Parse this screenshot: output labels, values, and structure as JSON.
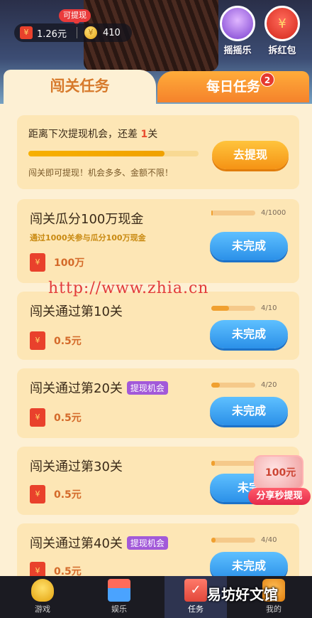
{
  "header": {
    "withdraw_tip": "可提现",
    "cash": "1.26元",
    "coins": "410",
    "shake_label": "摇摇乐",
    "red_packet_label": "拆红包"
  },
  "tabs": {
    "levels": "闯关任务",
    "daily": "每日任务",
    "daily_badge": "2"
  },
  "withdraw_card": {
    "title_prefix": "距离下次提现机会，还差 ",
    "remaining": "1",
    "title_suffix": "关",
    "progress": 0.8,
    "desc": "闯关即可提现！机会多多、金额不限！",
    "button": "去提现"
  },
  "tasks": [
    {
      "title": "闯关瓜分100万现金",
      "subtitle": "通过1000关参与瓜分100万现金",
      "reward": "100万",
      "progress_text": "4/1000",
      "progress": 0.004,
      "button": "未完成"
    },
    {
      "title": "闯关通过第10关",
      "reward": "0.5元",
      "progress_text": "4/10",
      "progress": 0.4,
      "button": "未完成"
    },
    {
      "title": "闯关通过第20关",
      "tag": "提现机会",
      "reward": "0.5元",
      "progress_text": "4/20",
      "progress": 0.2,
      "button": "未完成"
    },
    {
      "title": "闯关通过第30关",
      "reward": "0.5元",
      "button": "未完"
    },
    {
      "title": "闯关通过第40关",
      "tag": "提现机会",
      "reward": "0.5元",
      "progress_text": "4/40",
      "progress": 0.1,
      "button": "未完成"
    }
  ],
  "watermark": "http://www.zhia.cn",
  "share": {
    "label": "分享秒提现",
    "amount": "100元"
  },
  "nav": {
    "game": "游戏",
    "entertainment": "娱乐",
    "task": "任务",
    "mine": "我的"
  },
  "corner_watermark": "易坊好文馆"
}
